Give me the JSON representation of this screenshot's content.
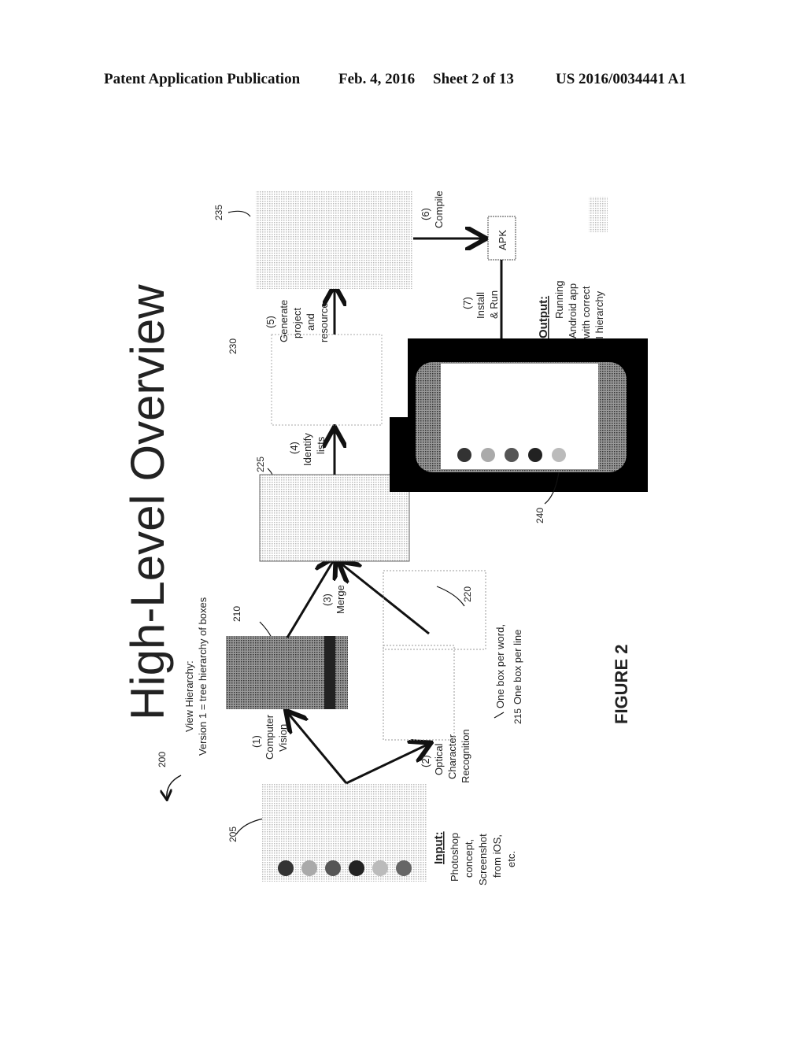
{
  "header": {
    "left": "Patent Application Publication",
    "date": "Feb. 4, 2016",
    "sheet": "Sheet 2 of 13",
    "pub_number": "US 2016/0034441 A1"
  },
  "figure": {
    "title": "High-Level Overview",
    "view_hierarchy_line1": "View Hierarchy:",
    "view_hierarchy_line2": "Version 1 = tree hierarchy of boxes",
    "caption": "FIGURE 2",
    "refs": {
      "r200": "200",
      "r205": "205",
      "r210": "210",
      "r215": "215",
      "r220": "220",
      "r225": "225",
      "r230": "230",
      "r235": "235",
      "r240": "240"
    },
    "steps": {
      "s1_num": "(1)",
      "s1_a": "Computer",
      "s1_b": "Vision",
      "s2_num": "(2)",
      "s2_a": "Optical",
      "s2_b": "Character",
      "s2_c": "Recognition",
      "s3_num": "(3)",
      "s3_a": "Merge",
      "s4_num": "(4)",
      "s4_a": "Identify",
      "s4_b": "lists",
      "s5_num": "(5)",
      "s5_a": "Generate",
      "s5_b": "project",
      "s5_c": "and",
      "s5_d": "resource",
      "s6_num": "(6)",
      "s6_a": "Compile",
      "s7_num": "(7)",
      "s7_a": "Install",
      "s7_b": "& Run"
    },
    "input": {
      "label": "Input:",
      "lines": [
        "Photoshop",
        "concept,",
        "Screenshot",
        "from iOS,",
        "etc."
      ]
    },
    "output": {
      "label": "Output:",
      "lines": [
        "Running",
        "Android app",
        "with correct",
        "UI hierarchy"
      ]
    },
    "ocr_note_1": "One box per word,",
    "ocr_note_2": "One box per line",
    "apk_label": "APK"
  }
}
